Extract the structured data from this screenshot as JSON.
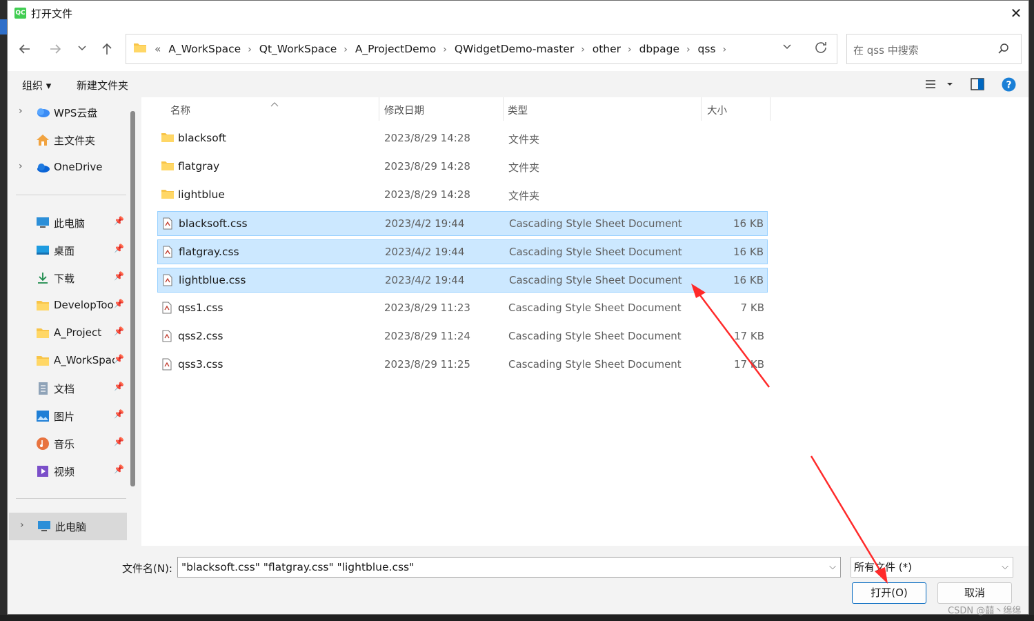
{
  "window": {
    "title": "打开文件",
    "app_icon_text": "QC"
  },
  "nav": {
    "path": [
      "«",
      "A_WorkSpace",
      "Qt_WorkSpace",
      "A_ProjectDemo",
      "QWidgetDemo-master",
      "other",
      "dbpage",
      "qss"
    ],
    "search_placeholder": "在 qss 中搜索"
  },
  "toolbar": {
    "organize": "组织 ▾",
    "new_folder": "新建文件夹"
  },
  "sidebar": {
    "items": [
      {
        "label": "WPS云盘",
        "icon": "wps-cloud-icon"
      },
      {
        "label": "主文件夹",
        "icon": "home-icon"
      },
      {
        "label": "OneDrive",
        "icon": "onedrive-icon"
      },
      {
        "label": "此电脑",
        "icon": "computer-icon"
      },
      {
        "label": "桌面",
        "icon": "desktop-icon"
      },
      {
        "label": "下载",
        "icon": "download-icon"
      },
      {
        "label": "DevelopTool",
        "icon": "folder-icon"
      },
      {
        "label": "A_Project",
        "icon": "folder-icon"
      },
      {
        "label": "A_WorkSpace",
        "icon": "folder-icon"
      },
      {
        "label": "文档",
        "icon": "documents-icon"
      },
      {
        "label": "图片",
        "icon": "pictures-icon"
      },
      {
        "label": "音乐",
        "icon": "music-icon"
      },
      {
        "label": "视频",
        "icon": "video-icon"
      },
      {
        "label": "此电脑",
        "icon": "computer-icon"
      }
    ]
  },
  "columns": {
    "name": "名称",
    "date": "修改日期",
    "type": "类型",
    "size": "大小"
  },
  "files": [
    {
      "name": "blacksoft",
      "date": "2023/8/29 14:28",
      "type": "文件夹",
      "size": "",
      "kind": "folder",
      "selected": false
    },
    {
      "name": "flatgray",
      "date": "2023/8/29 14:28",
      "type": "文件夹",
      "size": "",
      "kind": "folder",
      "selected": false
    },
    {
      "name": "lightblue",
      "date": "2023/8/29 14:28",
      "type": "文件夹",
      "size": "",
      "kind": "folder",
      "selected": false
    },
    {
      "name": "blacksoft.css",
      "date": "2023/4/2 19:44",
      "type": "Cascading Style Sheet Document",
      "size": "16 KB",
      "kind": "css",
      "selected": true
    },
    {
      "name": "flatgray.css",
      "date": "2023/4/2 19:44",
      "type": "Cascading Style Sheet Document",
      "size": "16 KB",
      "kind": "css",
      "selected": true
    },
    {
      "name": "lightblue.css",
      "date": "2023/4/2 19:44",
      "type": "Cascading Style Sheet Document",
      "size": "16 KB",
      "kind": "css",
      "selected": true
    },
    {
      "name": "qss1.css",
      "date": "2023/8/29 11:23",
      "type": "Cascading Style Sheet Document",
      "size": "7 KB",
      "kind": "css",
      "selected": false
    },
    {
      "name": "qss2.css",
      "date": "2023/8/29 11:24",
      "type": "Cascading Style Sheet Document",
      "size": "17 KB",
      "kind": "css",
      "selected": false
    },
    {
      "name": "qss3.css",
      "date": "2023/8/29 11:25",
      "type": "Cascading Style Sheet Document",
      "size": "17 KB",
      "kind": "css",
      "selected": false
    }
  ],
  "footer": {
    "filename_label": "文件名(N):",
    "filename_value": "\"blacksoft.css\" \"flatgray.css\" \"lightblue.css\"",
    "filetype_value": "所有文件 (*)",
    "open_button": "打开(O)",
    "cancel_button": "取消"
  },
  "watermark": "CSDN @囍丶绵绵",
  "colors": {
    "selection_bg": "#cce8ff",
    "selection_border": "#99d1ff",
    "accent": "#0067c0",
    "annotation_arrow": "#ff2a2a"
  }
}
